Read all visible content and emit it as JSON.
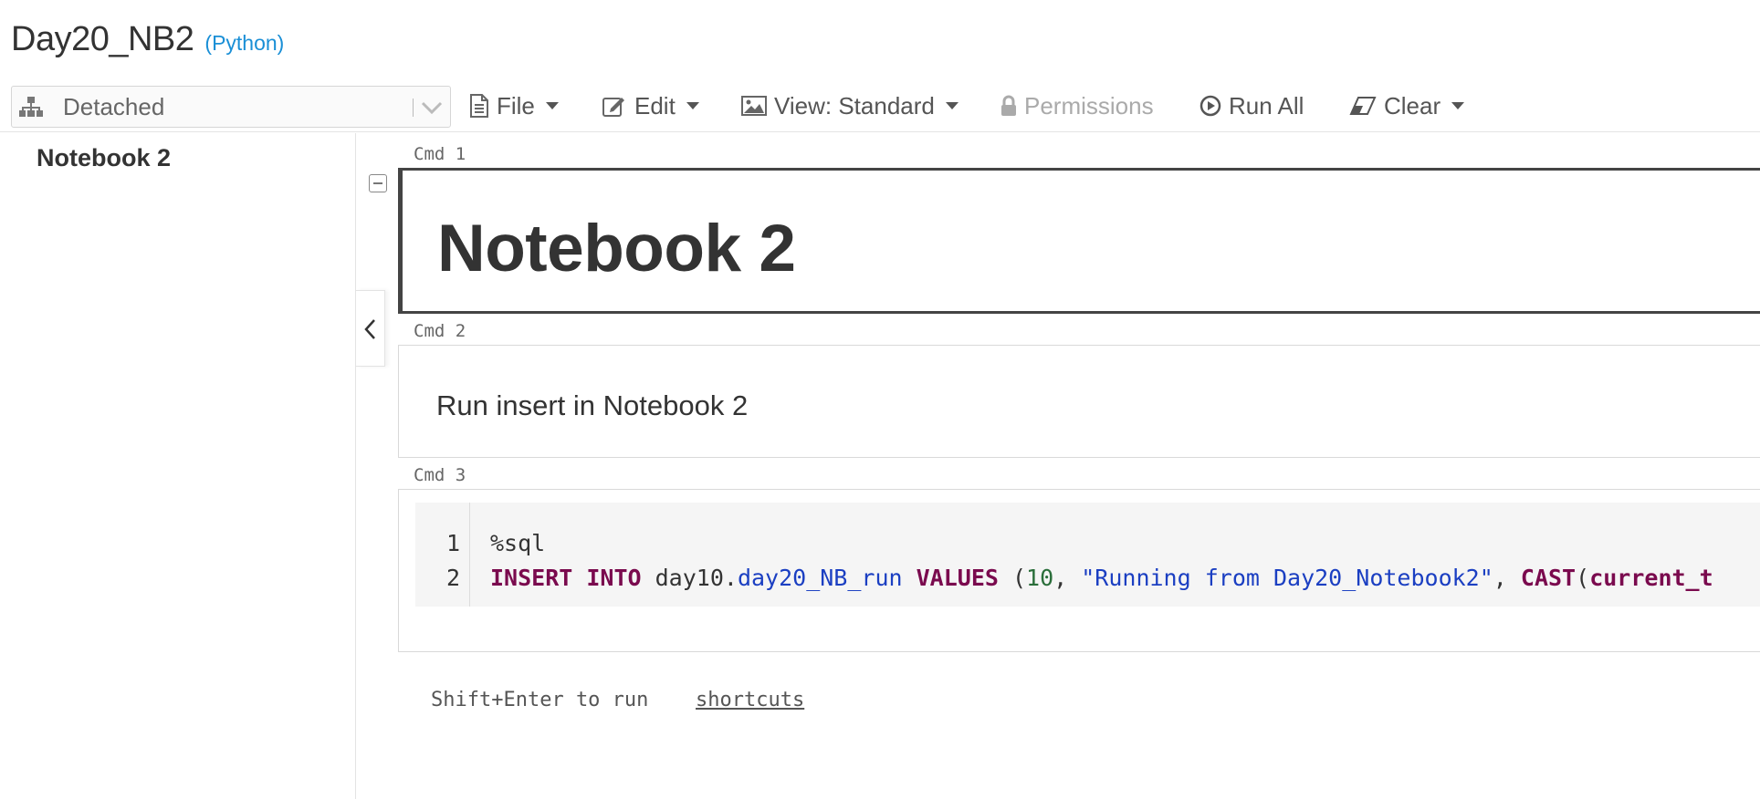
{
  "notebook": {
    "title": "Day20_NB2",
    "language": "(Python)"
  },
  "toolbar": {
    "cluster_status": "Detached",
    "file": "File",
    "edit": "Edit",
    "view": "View: Standard",
    "permissions": "Permissions",
    "run_all": "Run All",
    "clear": "Clear"
  },
  "sidebar": {
    "items": [
      {
        "label": "Notebook 2"
      }
    ]
  },
  "cells": [
    {
      "label": "Cmd 1",
      "heading": "Notebook 2"
    },
    {
      "label": "Cmd 2",
      "text": "Run insert in Notebook 2"
    },
    {
      "label": "Cmd 3",
      "line_numbers": [
        "1",
        "2"
      ],
      "line1": "%sql",
      "line2": {
        "kw_insert": "INSERT INTO",
        "schema": " day10.",
        "table": "day20_NB_run",
        "kw_values": " VALUES",
        "open": " (",
        "num": "10",
        "comma": ", ",
        "str": "\"Running from Day20_Notebook2\"",
        "comma2": ", ",
        "kw_cast": "CAST",
        "paren": "(",
        "fn": "current_t"
      }
    }
  ],
  "footer": {
    "hint": "Shift+Enter to run",
    "link": "shortcuts"
  }
}
